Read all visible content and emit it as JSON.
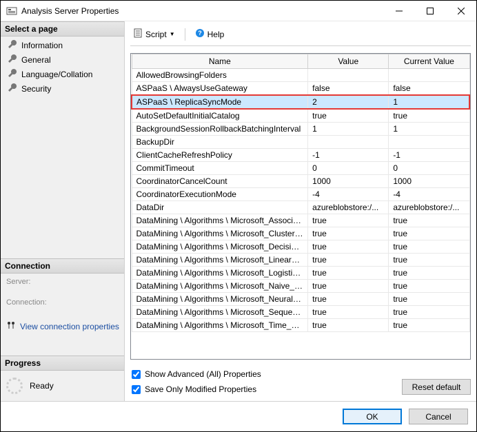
{
  "window": {
    "title": "Analysis Server Properties"
  },
  "nav": {
    "select_page": "Select a page",
    "items": [
      "Information",
      "General",
      "Language/Collation",
      "Security"
    ],
    "connection": "Connection",
    "server_label": "Server:",
    "connection_label": "Connection:",
    "view_conn": "View connection properties",
    "progress": "Progress",
    "ready": "Ready"
  },
  "toolbar": {
    "script": "Script",
    "help": "Help"
  },
  "grid": {
    "headers": {
      "name": "Name",
      "value": "Value",
      "current": "Current Value"
    },
    "rows": [
      {
        "name": "AllowedBrowsingFolders",
        "value": "",
        "current": ""
      },
      {
        "name": "ASPaaS \\ AlwaysUseGateway",
        "value": "false",
        "current": "false"
      },
      {
        "name": "ASPaaS \\ ReplicaSyncMode",
        "value": "2",
        "current": "1",
        "highlight": true
      },
      {
        "name": "AutoSetDefaultInitialCatalog",
        "value": "true",
        "current": "true"
      },
      {
        "name": "BackgroundSessionRollbackBatchingInterval",
        "value": "1",
        "current": "1"
      },
      {
        "name": "BackupDir",
        "value": "",
        "current": ""
      },
      {
        "name": "ClientCacheRefreshPolicy",
        "value": "-1",
        "current": "-1"
      },
      {
        "name": "CommitTimeout",
        "value": "0",
        "current": "0"
      },
      {
        "name": "CoordinatorCancelCount",
        "value": "1000",
        "current": "1000"
      },
      {
        "name": "CoordinatorExecutionMode",
        "value": "-4",
        "current": "-4"
      },
      {
        "name": "DataDir",
        "value": "azureblobstore:/...",
        "current": "azureblobstore:/..."
      },
      {
        "name": "DataMining \\ Algorithms \\ Microsoft_Associati...",
        "value": "true",
        "current": "true"
      },
      {
        "name": "DataMining \\ Algorithms \\ Microsoft_Clusterin...",
        "value": "true",
        "current": "true"
      },
      {
        "name": "DataMining \\ Algorithms \\ Microsoft_Decision...",
        "value": "true",
        "current": "true"
      },
      {
        "name": "DataMining \\ Algorithms \\ Microsoft_Linear_R...",
        "value": "true",
        "current": "true"
      },
      {
        "name": "DataMining \\ Algorithms \\ Microsoft_Logistic_...",
        "value": "true",
        "current": "true"
      },
      {
        "name": "DataMining \\ Algorithms \\ Microsoft_Naive_B...",
        "value": "true",
        "current": "true"
      },
      {
        "name": "DataMining \\ Algorithms \\ Microsoft_Neural_...",
        "value": "true",
        "current": "true"
      },
      {
        "name": "DataMining \\ Algorithms \\ Microsoft_Sequenc...",
        "value": "true",
        "current": "true"
      },
      {
        "name": "DataMining \\ Algorithms \\ Microsoft_Time_Se...",
        "value": "true",
        "current": "true"
      }
    ]
  },
  "checks": {
    "show_adv": "Show Advanced (All) Properties",
    "save_mod": "Save Only Modified Properties",
    "reset": "Reset default"
  },
  "footer": {
    "ok": "OK",
    "cancel": "Cancel"
  }
}
